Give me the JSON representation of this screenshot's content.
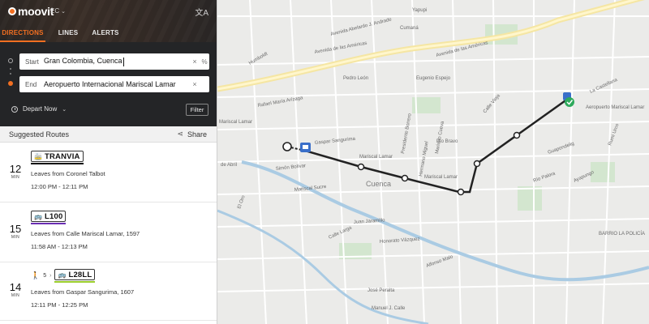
{
  "app": {
    "brand": "moovit",
    "region": "EC"
  },
  "tabs": [
    {
      "label": "DIRECTIONS",
      "active": true
    },
    {
      "label": "LINES",
      "active": false
    },
    {
      "label": "ALERTS",
      "active": false
    }
  ],
  "search": {
    "start_label": "Start",
    "start_value": "Gran Colombia, Cuenca",
    "end_label": "End",
    "end_value": "Aeropuerto Internacional Mariscal Lamar"
  },
  "options": {
    "depart_label": "Depart Now",
    "filter_label": "Filter"
  },
  "suggested": {
    "title": "Suggested Routes",
    "share_label": "Share"
  },
  "routes": [
    {
      "duration": "12",
      "unit": "MIN",
      "line": "TRANVIA",
      "line_color": "#111111",
      "walk": "",
      "leaves": "Leaves from Coronel Talbot",
      "times": "12:00 PM - 12:11 PM"
    },
    {
      "duration": "15",
      "unit": "MIN",
      "line": "L100",
      "line_color": "#6b2fb3",
      "walk": "",
      "leaves": "Leaves from Calle Mariscal Lamar, 1597",
      "times": "11:58 AM - 12:13 PM"
    },
    {
      "duration": "14",
      "unit": "MIN",
      "line": "L28LL",
      "line_color": "#9acd2a",
      "walk": "5",
      "leaves": "Leaves from Gaspar Sangurima, 1607",
      "times": "12:11 PM - 12:25 PM"
    }
  ],
  "map": {
    "labels": {
      "yapupi": "Yapupi",
      "cumana": "Cumaná",
      "av_abelardo": "Avenida Abelardo J. Andrade",
      "av_americas_1": "Avenida de las Américas",
      "av_americas_2": "Avenida de las Américas",
      "calle_vieja": "Calle Vieja",
      "la_castellana": "La Castellana",
      "humboldt": "Humboldt",
      "pedro_leon": "Pedro León",
      "eugenio_espejo": "Eugenio Espejo",
      "rafael_ariza": "Rafael María Arízaga",
      "mariscal_lamar_1": "Mariscal Lamar",
      "mariscal_lamar_2": "Mariscal Lamar",
      "mariscal_lamar_3": "Mariscal Lamar",
      "gaspar": "Gaspar Sangurima",
      "presidente_borrero": "Presidente Borrero",
      "hermano_miguel": "Hermano Miguel",
      "mariano_cueva": "Mariano Cueva",
      "pio_bravo": "Pío Bravo",
      "simon_bolivar": "Simón Bolívar",
      "mariscal_sucre": "Mariscal Sucre",
      "cuenca": "Cuenca",
      "juan_jaramillo": "Juan Jaramillo",
      "calle_larga": "Calle Larga",
      "honorato": "Honorato Vázquez",
      "alfonso_malo": "Alfonso Malo",
      "jose_peralta": "José Peralta",
      "manuel_julio": "Manuel J. Calle",
      "guapondelig": "Guapondelig",
      "rio_palora": "Río Palora",
      "rumi_urco": "Rumi Urco",
      "ayapungo": "Ayapungo",
      "barrio_policia": "BARRIO LA POLICÍA",
      "airport": "Aeropuerto Mariscal Lamar",
      "del_arbol": "de Abril",
      "el_oro": "El Oro",
      "sangurima_loc": "Sangurima"
    }
  }
}
